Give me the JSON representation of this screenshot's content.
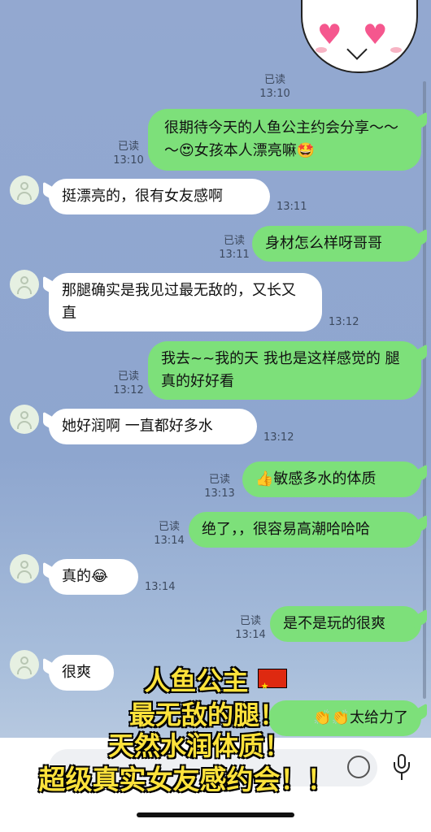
{
  "messages": [
    {
      "side": "out",
      "read": "已读",
      "time": "13:10",
      "text": "很期待今天的人鱼公主约会分享～～～😍女孩本人漂亮嘛🤩"
    },
    {
      "side": "in",
      "time": "13:11",
      "text": "挺漂亮的，很有女友感啊"
    },
    {
      "side": "out",
      "read": "已读",
      "time": "13:11",
      "text": "身材怎么样呀哥哥"
    },
    {
      "side": "in",
      "time": "13:12",
      "text": "那腿确实是我见过最无敌的，又长又直"
    },
    {
      "side": "out",
      "read": "已读",
      "time": "13:12",
      "text": "我去~~我的天 我也是这样感觉的 腿真的好好看"
    },
    {
      "side": "in",
      "time": "13:12",
      "text": "她好润啊 一直都好多水"
    },
    {
      "side": "out",
      "read": "已读",
      "time": "13:13",
      "text": "👍敏感多水的体质"
    },
    {
      "side": "out",
      "read": "已读",
      "time": "13:14",
      "text": "绝了，，很容易高潮哈哈哈"
    },
    {
      "side": "in",
      "time": "13:14",
      "text": "真的😂"
    },
    {
      "side": "out",
      "read": "已读",
      "time": "13:14",
      "text": "是不是玩的很爽"
    },
    {
      "side": "in",
      "time": "",
      "text": "很爽"
    },
    {
      "side": "out",
      "read": "",
      "time": "",
      "text": "👏👏太给力了"
    }
  ],
  "top_status": {
    "read": "已读",
    "time": "13:10"
  },
  "overlay": {
    "line1": "人鱼公主",
    "line2": "最无敌的腿！",
    "line3": "天然水润体质！",
    "line4": "超级真实女友感约会！！"
  },
  "colors": {
    "out_bubble": "#7de07a",
    "in_bubble": "#ffffff",
    "overlay_text": "#fde23b"
  }
}
